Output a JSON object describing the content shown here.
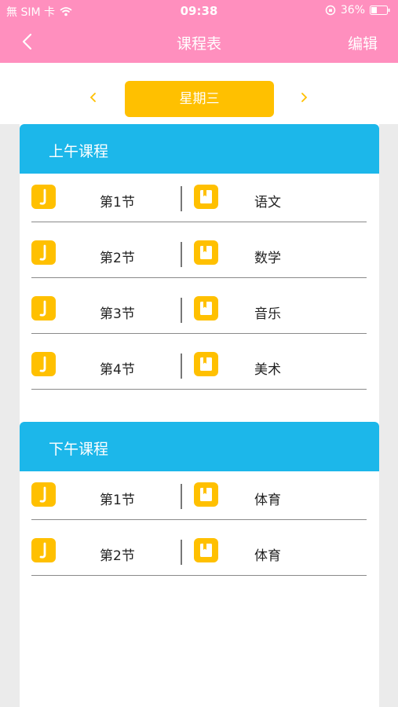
{
  "status": {
    "carrier": "無 SIM 卡",
    "time": "09:38",
    "battery": "36%"
  },
  "nav": {
    "title": "课程表",
    "edit_label": "编辑"
  },
  "day": {
    "label": "星期三"
  },
  "morning": {
    "title": "上午课程",
    "rows": [
      {
        "period": "第1节",
        "subject": "语文"
      },
      {
        "period": "第2节",
        "subject": "数学"
      },
      {
        "period": "第3节",
        "subject": "音乐"
      },
      {
        "period": "第4节",
        "subject": "美术"
      }
    ]
  },
  "afternoon": {
    "title": "下午课程",
    "rows": [
      {
        "period": "第1节",
        "subject": "体育"
      },
      {
        "period": "第2节",
        "subject": "体育"
      }
    ]
  },
  "colors": {
    "header_pink": "#ff8fbe",
    "accent_yellow": "#ffc000",
    "section_blue": "#1cb7ea"
  },
  "icons": {
    "period_icon": "music-note-icon",
    "subject_icon": "book-icon"
  }
}
